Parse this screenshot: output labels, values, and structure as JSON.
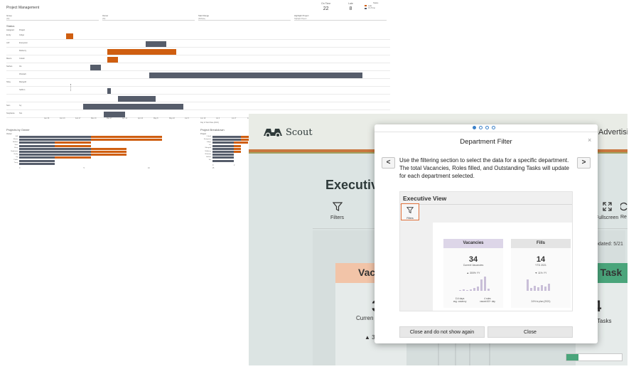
{
  "pm": {
    "title": "Project Management",
    "kpis": [
      {
        "label": "On Time",
        "value": "22"
      },
      {
        "label": "Late",
        "value": "8"
      }
    ],
    "legend": {
      "title": "Status",
      "items": [
        {
          "label": "Late",
          "color": "#cf5e10"
        },
        {
          "label": "On Time",
          "color": "#565d6b"
        }
      ]
    },
    "filters": [
      {
        "label": "Group",
        "value": "(All)"
      },
      {
        "label": "Owner",
        "value": "(All)"
      },
      {
        "label": "Start Range",
        "value": "(Multiple)"
      },
      {
        "label": "Highlight Project",
        "value": "Highlight Project"
      }
    ],
    "status_label": "Status",
    "gantt_headers": [
      "Assigned",
      "Project"
    ],
    "gantt_rows": [
      {
        "group": "Emily",
        "project": "Indigo",
        "start": 0.06,
        "end": 0.08,
        "status": "late"
      },
      {
        "group": "Jeff",
        "project": "Evergreen",
        "start": 0.29,
        "end": 0.35,
        "status": "on_time"
      },
      {
        "group": "",
        "project": "Mulberry",
        "start": 0.18,
        "end": 0.38,
        "status": "late"
      },
      {
        "group": "Mauro",
        "project": "Cobalt",
        "start": 0.18,
        "end": 0.21,
        "status": "late"
      },
      {
        "group": "Nathan",
        "project": "Iris",
        "start": 0.13,
        "end": 0.16,
        "status": "on_time"
      },
      {
        "group": "",
        "project": "Rhubarb",
        "start": 0.3,
        "end": 0.92,
        "status": "on_time"
      },
      {
        "group": "Shay",
        "project": "Marigold",
        "start": 0,
        "end": 0,
        "status": "none"
      },
      {
        "group": "",
        "project": "Saffron",
        "start": 0.18,
        "end": 0.19,
        "status": "on_time"
      },
      {
        "group": "",
        "project": "",
        "start": 0.21,
        "end": 0.32,
        "status": "on_time"
      },
      {
        "group": "Sam",
        "project": "Ivy",
        "start": 0.11,
        "end": 0.4,
        "status": "on_time"
      },
      {
        "group": "Stephanie",
        "project": "Tan",
        "start": 0.17,
        "end": 0.23,
        "status": "on_time"
      }
    ],
    "axis_ticks": [
      "Jan 30",
      "Feb 13",
      "Feb 27",
      "Mar 13",
      "Mar 27",
      "Apr 10",
      "Apr 24",
      "May 8",
      "May 22",
      "Jun 5",
      "Jun 19",
      "Jul 3",
      "Jul 17",
      "Jul 31"
    ],
    "axis_title": "Day of Start Date [2021]",
    "projects_by_owner": {
      "title": "Projects by Owner",
      "head": "Owner",
      "rows": [
        {
          "label": "Jeff",
          "on_time": 0.2,
          "late": 0.2
        },
        {
          "label": "Mauro",
          "on_time": 0.2,
          "late": 0.2
        },
        {
          "label": "Nathan",
          "on_time": 0.1,
          "late": 0.1
        },
        {
          "label": "Sam",
          "on_time": 0.1,
          "late": 0.1
        },
        {
          "label": "Shay",
          "on_time": 0.2,
          "late": 0.1
        },
        {
          "label": "Stephanie",
          "on_time": 0.2,
          "late": 0.1
        },
        {
          "label": "Emily",
          "on_time": 0.2,
          "late": 0.1
        },
        {
          "label": "Ivy",
          "on_time": 0.1,
          "late": 0.1
        },
        {
          "label": "Pablo",
          "on_time": 0.1,
          "late": 0.0
        },
        {
          "label": "Tracy",
          "on_time": 0.1,
          "late": 0.0
        }
      ],
      "axis": [
        "0",
        "5",
        "10",
        "15",
        "20",
        "25"
      ]
    },
    "project_breakdown": {
      "title": "Project Breakdown",
      "head": "Project",
      "rows": [
        {
          "label": "Cobalt",
          "on_time": 0.4,
          "late": 0.2
        },
        {
          "label": "Evergreen",
          "on_time": 0.4,
          "late": 0.2
        },
        {
          "label": "Indigo",
          "on_time": 0.3,
          "late": 0.2
        },
        {
          "label": "Iris",
          "on_time": 0.3,
          "late": 0.1
        },
        {
          "label": "Marigold",
          "on_time": 0.3,
          "late": 0.1
        },
        {
          "label": "Mulberry",
          "on_time": 0.3,
          "late": 0.1
        },
        {
          "label": "Rhubarb",
          "on_time": 0.3,
          "late": 0.0
        },
        {
          "label": "Saffron",
          "on_time": 0.3,
          "late": 0.0
        },
        {
          "label": "Tan",
          "on_time": 0.3,
          "late": 0.0
        }
      ],
      "axis": [
        "0",
        "2",
        "4",
        "6"
      ]
    }
  },
  "scout": {
    "logo_text": "Scout",
    "header_right": "Advertising",
    "page_title": "Executive",
    "toolbar": {
      "filters_label": "Filters",
      "fullscreen_label": "Fullscreen",
      "r_label": "Re"
    },
    "card_left_title": "Vac",
    "card_left_big": "3",
    "card_left_sub": "Curren",
    "card_left_delta": "▲ 3",
    "card_right_title": "g Task",
    "card_right_big": "4",
    "card_right_sub": "Tasks",
    "updated_text": "pdated: 5/21",
    "progress": 0.22
  },
  "modal": {
    "title": "Department Filter",
    "body": "Use the filtering section to select the data for a specific department. The total Vacancies, Roles filled, and Outstanding Tasks will update for each department selected.",
    "page_count": 4,
    "active_page": 0,
    "prev_label": "<",
    "next_label": ">",
    "close_x": "×",
    "preview": {
      "title": "Executive View",
      "filter_label": "Filters",
      "cards": [
        {
          "head": "Vacancies",
          "value": "34",
          "sub": "Current Vacancies",
          "delta": "▲ 300% YY",
          "bars": [
            0.05,
            0.08,
            0.05,
            0.1,
            0.2,
            0.3,
            0.8,
            1.0,
            0.15
          ],
          "foot_left": "114 days\navg. vacancy",
          "foot_right": "4 roles\nvacant 60+ day"
        },
        {
          "head": "Fills",
          "value": "14",
          "sub": "YTD 2021",
          "delta": "▼ 11% YY",
          "bars": [
            0.8,
            0.2,
            0.35,
            0.25,
            0.4,
            0.3,
            0.5
          ],
          "foot": "24% to plan (2021)"
        }
      ]
    },
    "btn_close_no_show": "Close and do not show again",
    "btn_close": "Close"
  },
  "colors": {
    "late": "#cf5e10",
    "on_time": "#565d6b",
    "accent_orange": "#e0703a",
    "scout_green": "#4aa57b"
  }
}
